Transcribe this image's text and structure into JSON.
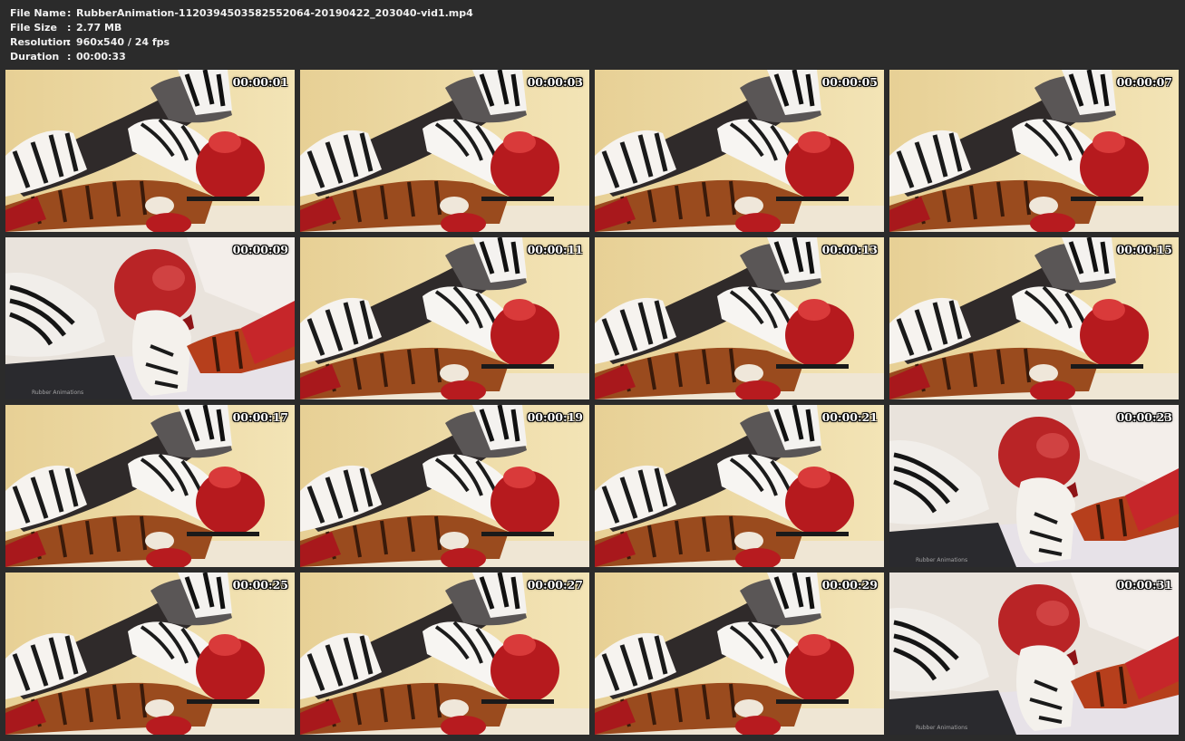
{
  "file_info": [
    {
      "key": "File Name",
      "value": "RubberAnimation-1120394503582552064-20190422_203040-vid1.mp4"
    },
    {
      "key": "File Size",
      "value": "2.77 MB"
    },
    {
      "key": "Resolution",
      "value": "960x540 / 24 fps"
    },
    {
      "key": "Duration",
      "value": "00:00:33"
    }
  ],
  "separator": ":",
  "watermark": "Rubber Animations",
  "thumbnails": [
    {
      "time": "00:00:01",
      "scene": "a",
      "watermark": false
    },
    {
      "time": "00:00:03",
      "scene": "a",
      "watermark": false
    },
    {
      "time": "00:00:05",
      "scene": "a",
      "watermark": false
    },
    {
      "time": "00:00:07",
      "scene": "a",
      "watermark": false
    },
    {
      "time": "00:00:09",
      "scene": "b",
      "watermark": true
    },
    {
      "time": "00:00:11",
      "scene": "a",
      "watermark": false
    },
    {
      "time": "00:00:13",
      "scene": "a",
      "watermark": false
    },
    {
      "time": "00:00:15",
      "scene": "a",
      "watermark": false
    },
    {
      "time": "00:00:17",
      "scene": "a",
      "watermark": false
    },
    {
      "time": "00:00:19",
      "scene": "a",
      "watermark": false
    },
    {
      "time": "00:00:21",
      "scene": "a",
      "watermark": false
    },
    {
      "time": "00:00:23",
      "scene": "b",
      "watermark": true
    },
    {
      "time": "00:00:25",
      "scene": "a",
      "watermark": false
    },
    {
      "time": "00:00:27",
      "scene": "a",
      "watermark": false
    },
    {
      "time": "00:00:29",
      "scene": "a",
      "watermark": false
    },
    {
      "time": "00:00:31",
      "scene": "b",
      "watermark": true
    }
  ]
}
